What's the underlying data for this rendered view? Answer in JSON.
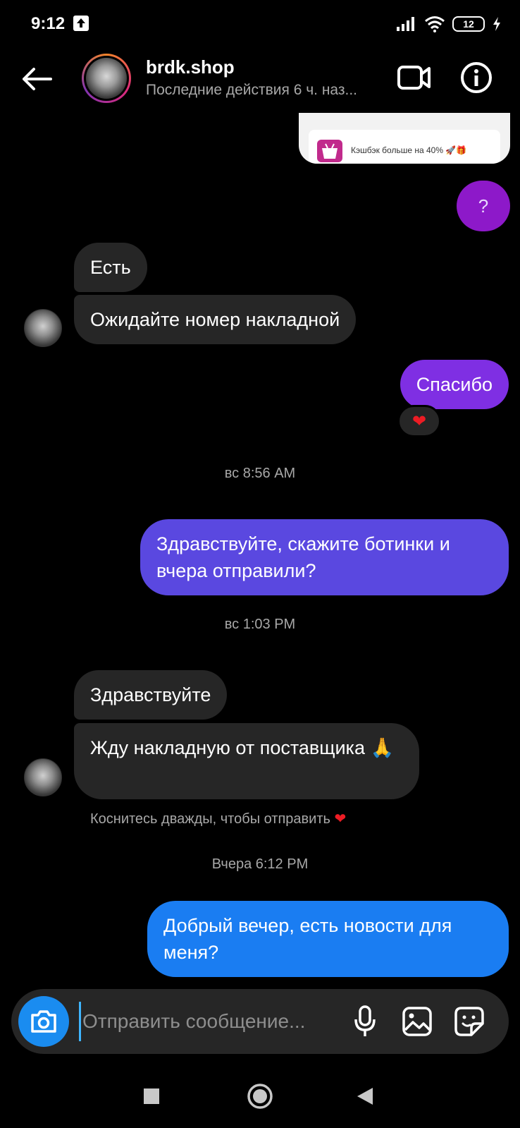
{
  "status_bar": {
    "time": "9:12",
    "battery": "12"
  },
  "header": {
    "name": "brdk.shop",
    "subtitle": "Последние действия 6 ч. наз..."
  },
  "preview": {
    "text": "Кэшбэк больше на 40% 🚀🎁"
  },
  "messages": {
    "q_mark": "?",
    "in_1": "Есть",
    "in_2": "Ожидайте номер накладной",
    "out_1": "Спасибо",
    "reaction_1": "❤",
    "ts_1": "вс 8:56 AM",
    "out_2": "Здравствуйте, скажите ботинки и вчера отправили?",
    "ts_2": "вс 1:03 PM",
    "in_3": "Здравствуйте",
    "in_4": "Жду накладную от поставщика 🙏",
    "hint": "Коснитесь дважды, чтобы отправить",
    "hint_heart": "❤",
    "ts_3": "Вчера 6:12 PM",
    "out_3": "Добрый вечер, есть новости для меня?"
  },
  "composer": {
    "placeholder": "Отправить сообщение..."
  },
  "colors": {
    "incoming": "#262626",
    "purple": "#8d19c9",
    "violet": "#7f2fe3",
    "indigo": "#5a48e0",
    "blue": "#1a7df2",
    "camera": "#1a8cf0"
  }
}
